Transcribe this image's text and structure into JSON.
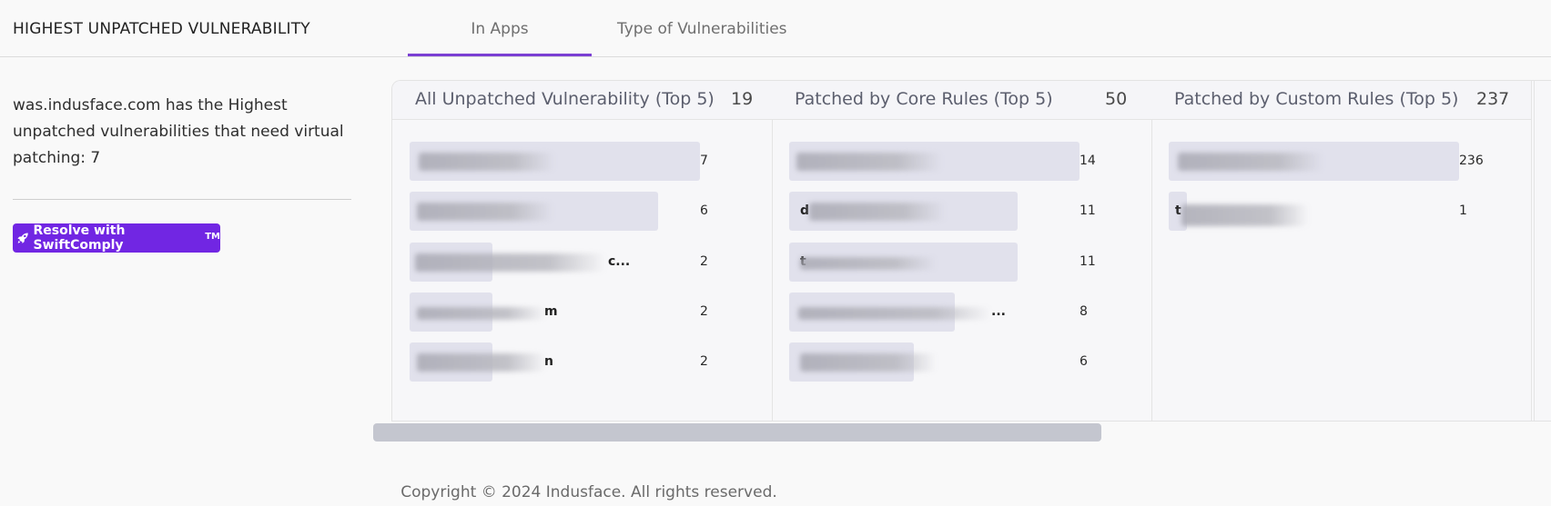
{
  "header": {
    "title": "HIGHEST UNPATCHED VULNERABILITY",
    "tabs": [
      {
        "label": "In Apps",
        "active": true
      },
      {
        "label": "Type of Vulnerabilities",
        "active": false
      }
    ]
  },
  "summary": {
    "text": "was.indusface.com has the Highest unpatched vulnerabilities that need virtual patching: 7",
    "button_label": "Resolve with SwiftComply",
    "button_sup": "TM"
  },
  "columns": [
    {
      "title": "All Unpatched Vulnerability (Top 5)",
      "count": "19",
      "rows": [
        {
          "label": "",
          "value": "7",
          "fill": 1.0
        },
        {
          "label": "",
          "value": "6",
          "fill": 0.857
        },
        {
          "label": "c...",
          "value": "2",
          "fill": 0.286
        },
        {
          "label": "m",
          "value": "2",
          "fill": 0.286
        },
        {
          "label": "n",
          "value": "2",
          "fill": 0.286
        }
      ]
    },
    {
      "title": "Patched by Core Rules (Top 5)",
      "count": "50",
      "rows": [
        {
          "label": "",
          "value": "14",
          "fill": 1.0
        },
        {
          "label": "d",
          "value": "11",
          "fill": 0.786
        },
        {
          "label": "t",
          "value": "11",
          "fill": 0.786
        },
        {
          "label": "...",
          "value": "8",
          "fill": 0.571
        },
        {
          "label": "",
          "value": "6",
          "fill": 0.429
        }
      ]
    },
    {
      "title": "Patched by Custom Rules (Top 5)",
      "count": "237",
      "rows": [
        {
          "label": "",
          "value": "236",
          "fill": 1.0
        },
        {
          "label": "t",
          "value": "1",
          "fill": 0.06
        }
      ]
    }
  ],
  "footer": {
    "copyright": "Copyright © 2024 Indusface. All rights reserved."
  }
}
